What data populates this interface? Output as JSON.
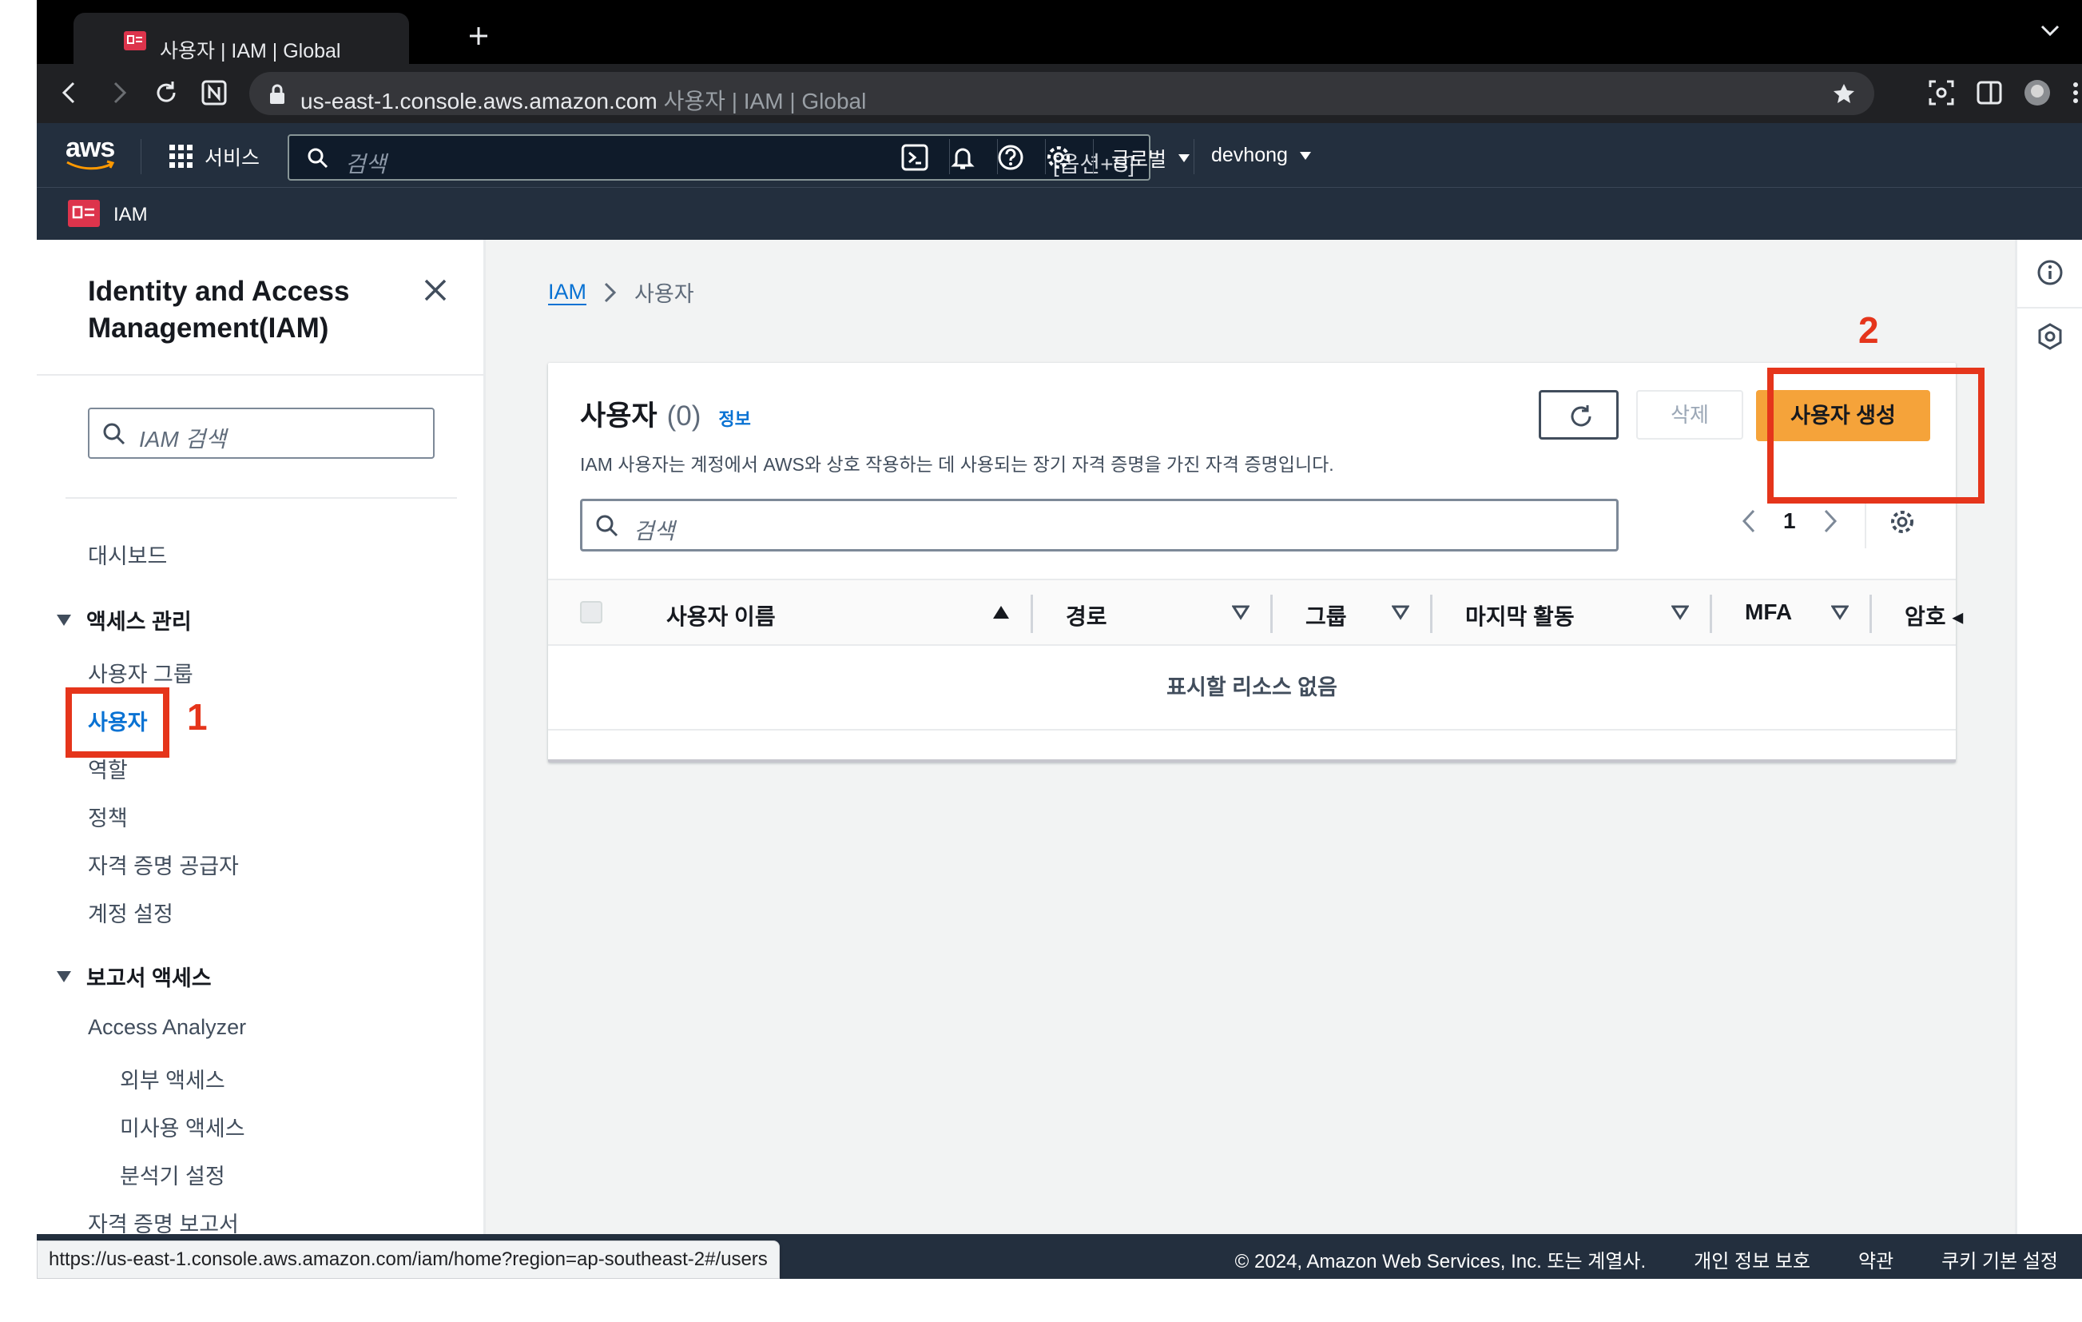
{
  "browser": {
    "tab_title": "사용자 | IAM | Global",
    "url_host": "us-east-1.console.aws.amazon.com",
    "url_page_title": "사용자 | IAM | Global",
    "status_url": "https://us-east-1.console.aws.amazon.com/iam/home?region=ap-southeast-2#/users"
  },
  "aws_nav": {
    "logo_text": "aws",
    "services_label": "서비스",
    "search_placeholder": "검색",
    "search_shortcut": "[옵션+S]",
    "region_label": "글로벌",
    "account_label": "devhong"
  },
  "service_bar": {
    "label": "IAM"
  },
  "sidebar": {
    "title": "Identity and Access Management(IAM)",
    "search_placeholder": "IAM 검색",
    "dashboard": "대시보드",
    "section_access": "액세스 관리",
    "access_items": [
      "사용자 그룹",
      "사용자",
      "역할",
      "정책",
      "자격 증명 공급자",
      "계정 설정"
    ],
    "section_reports": "보고서 액세스",
    "access_analyzer": "Access Analyzer",
    "analyzer_items": [
      "외부 액세스",
      "미사용 액세스",
      "분석기 설정"
    ],
    "credential_report": "자격 증명 보고서"
  },
  "annotations": {
    "step1": "1",
    "step2": "2"
  },
  "main": {
    "breadcrumb": {
      "root": "IAM",
      "current": "사용자"
    },
    "panel": {
      "title": "사용자",
      "count": "(0)",
      "info_link": "정보",
      "description": "IAM 사용자는 계정에서 AWS와 상호 작용하는 데 사용되는 장기 자격 증명을 가진 자격 증명입니다.",
      "delete_label": "삭제",
      "create_label": "사용자 생성",
      "search_placeholder": "검색",
      "page_number": "1",
      "columns": [
        "사용자 이름",
        "경로",
        "그룹",
        "마지막 활동",
        "MFA",
        "암호 ◂"
      ],
      "empty_text": "표시할 리소스 없음"
    }
  },
  "footer": {
    "copyright": "© 2024, Amazon Web Services, Inc. 또는 계열사.",
    "privacy": "개인 정보 보호",
    "terms": "약관",
    "cookies": "쿠키 기본 설정"
  },
  "colors": {
    "aws_nav_bg": "#232f3e",
    "link_blue": "#0972d3",
    "primary_orange": "#f5a33a",
    "annotation_red": "#e5351b"
  }
}
